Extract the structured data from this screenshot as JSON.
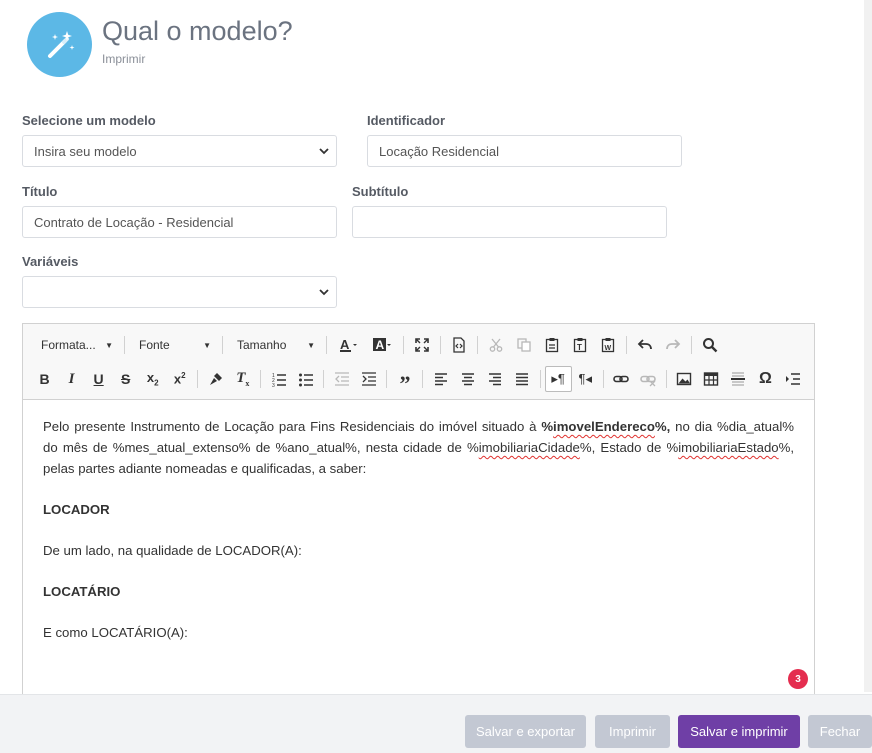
{
  "header": {
    "title": "Qual o modelo?",
    "subtitle": "Imprimir",
    "icon": "magic-wand-icon",
    "icon_color": "#5cb8e6"
  },
  "form": {
    "model": {
      "label": "Selecione um modelo",
      "value": "Insira seu modelo"
    },
    "identifier": {
      "label": "Identificador",
      "value": "Locação Residencial"
    },
    "title": {
      "label": "Título",
      "value": "Contrato de Locação - Residencial"
    },
    "subtitle": {
      "label": "Subtítulo",
      "value": ""
    },
    "variables": {
      "label": "Variáveis",
      "value": ""
    }
  },
  "toolbar": {
    "format": "Formata...",
    "font": "Fonte",
    "size": "Tamanho"
  },
  "editor": {
    "p1": {
      "a": "Pelo presente Instrumento de Locação para Fins Residenciais do imóvel situado à ",
      "b_pre": "%",
      "b_word": "imovelEndereco",
      "b_post": "%,",
      "c": " no dia %dia_atual% do mês de %mes_atual_extenso% de %ano_atual%, nesta cidade de %",
      "d_word": "imobiliariaCidade",
      "e": "%, Estado de %",
      "f_word": "imobiliariaEstado",
      "g": "%, pelas partes adiante nomeadas e qualificadas, a saber:"
    },
    "locador_heading": "LOCADOR",
    "locador_text": "De um lado, na qualidade de LOCADOR(A):",
    "locatario_heading": "LOCATÁRIO",
    "locatario_text": "E como LOCATÁRIO(A):"
  },
  "badge": {
    "count": "3",
    "color": "#e42d4f"
  },
  "footer": {
    "save_export": "Salvar e exportar",
    "print": "Imprimir",
    "save_print": "Salvar e imprimir",
    "close": "Fechar",
    "primary_color": "#6f3fa6",
    "muted_color": "#c3c8d3"
  }
}
